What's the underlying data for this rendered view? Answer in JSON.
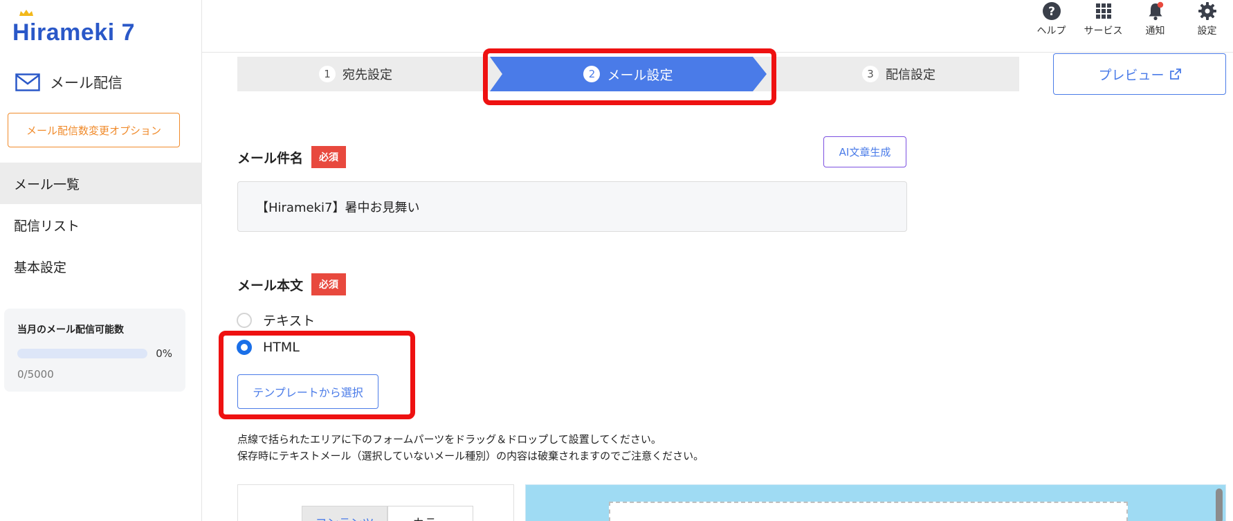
{
  "app": {
    "logo_text": "Hirameki 7",
    "section_title": "メール配信"
  },
  "sidebar": {
    "option_button": "メール配信数変更オプション",
    "items": [
      {
        "label": "メール一覧",
        "active": true
      },
      {
        "label": "配信リスト",
        "active": false
      },
      {
        "label": "基本設定",
        "active": false
      }
    ],
    "quota": {
      "title": "当月のメール配信可能数",
      "percent_label": "0%",
      "percent_value": 0,
      "count": "0/5000"
    }
  },
  "header": {
    "icons": [
      {
        "icon": "help-icon",
        "label": "ヘルプ"
      },
      {
        "icon": "grid-icon",
        "label": "サービス"
      },
      {
        "icon": "bell-icon",
        "label": "通知",
        "badge": true
      },
      {
        "icon": "gear-icon",
        "label": "設定"
      }
    ]
  },
  "steps": [
    {
      "num": "1",
      "label": "宛先設定"
    },
    {
      "num": "2",
      "label": "メール設定",
      "active": true
    },
    {
      "num": "3",
      "label": "配信設定"
    }
  ],
  "preview_button": "プレビュー",
  "form": {
    "subject_label": "メール件名",
    "required_badge": "必須",
    "ai_button": "AI文章生成",
    "subject_value": "【Hirameki7】暑中お見舞い",
    "body_label": "メール本文",
    "radio_text": "テキスト",
    "radio_html": "HTML",
    "selected_format": "HTML",
    "template_button": "テンプレートから選択",
    "note_line1": "点線で括られたエリアに下のフォームパーツをドラッグ＆ドロップして設置してください。",
    "note_line2": "保存時にテキストメール（選択していないメール種別）の内容は破棄されますのでご注意ください。"
  },
  "editor": {
    "tabs": [
      {
        "label": "コンテンツ",
        "active": true
      },
      {
        "label": "カラー",
        "active": false
      }
    ]
  },
  "colors": {
    "accent": "#4a7be8",
    "highlight": "#ee1111",
    "required": "#e8493e",
    "option": "#f08a2a",
    "canvas_bg": "#9fdbf3"
  }
}
